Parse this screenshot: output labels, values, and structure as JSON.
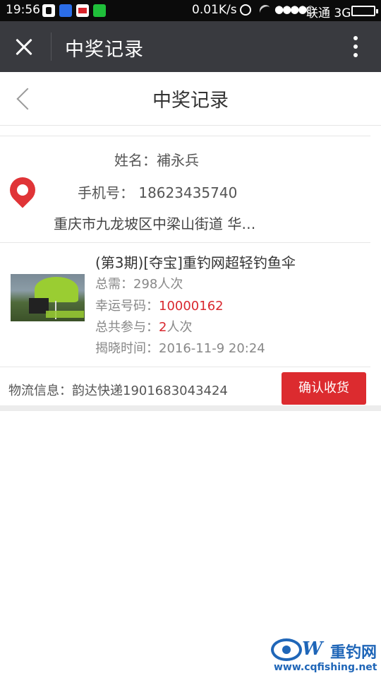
{
  "status_bar": {
    "time": "19:56",
    "speed": "0.01K/s",
    "signal_dots": "●●●●○",
    "carrier": "联通 3G"
  },
  "wechat_nav": {
    "title": "中奖记录"
  },
  "page": {
    "title": "中奖记录"
  },
  "address": {
    "name": "姓名：補永兵",
    "phone": "手机号：  18623435740",
    "detail": "重庆市九龙坡区中梁山街道 华…"
  },
  "product": {
    "title": "(第3期)[夺宝]重钓网超轻钓鱼伞",
    "total_needed": "总需：298人次",
    "lucky_label": "幸运号码：",
    "lucky_number": "10000162",
    "participate_label": "总共参与：",
    "participate_count": "2",
    "participate_unit": "人次",
    "reveal_time": "揭晓时间：2016-11-9 20:24"
  },
  "logistics": {
    "text": "物流信息：韵达快递1901683043424",
    "confirm_label": "确认收货"
  },
  "watermark": {
    "logo_letter": "W",
    "name": "重钓网",
    "url": "www.cqfishing.net"
  },
  "colors": {
    "accent_red": "#dc2b2f",
    "nav_bg": "#393a3f",
    "watermark_blue": "#1f66b8"
  }
}
